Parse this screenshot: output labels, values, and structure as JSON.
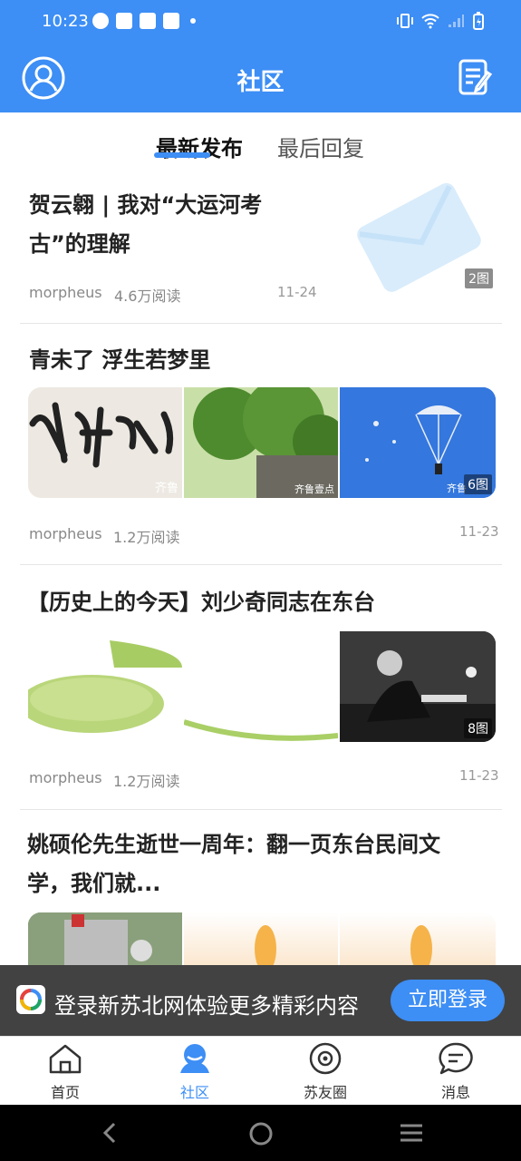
{
  "status_bar": {
    "time": "10:23"
  },
  "header": {
    "title": "社区"
  },
  "tabs": [
    {
      "label": "最新发布"
    },
    {
      "label": "最后回复"
    }
  ],
  "posts": [
    {
      "title_line1": "贺云翱 | 我对“大运河考",
      "title_line2": "古”的理解",
      "author": "morpheus",
      "reads": "4.6万阅读",
      "date": "11-24",
      "image_count": "2图"
    },
    {
      "title": "青未了 浮生若梦里",
      "author": "morpheus",
      "reads": "1.2万阅读",
      "date": "11-23",
      "watermark": "齐鲁",
      "watermark2": "齐鲁壹点",
      "image_count": "6图"
    },
    {
      "title": "【历史上的今天】刘少奇同志在东台",
      "author": "morpheus",
      "reads": "1.2万阅读",
      "date": "11-23",
      "image_count": "8图"
    },
    {
      "title_line1": "姚硕伦先生逝世一周年：翻一页东台民间文",
      "title_line2": "学，我们就..."
    }
  ],
  "banner": {
    "text": "登录新苏北网体验更多精彩内容",
    "button": "立即登录"
  },
  "bottom_nav": [
    {
      "label": "首页",
      "icon": "home-icon"
    },
    {
      "label": "社区",
      "icon": "community-icon"
    },
    {
      "label": "苏友圈",
      "icon": "circle-icon"
    },
    {
      "label": "消息",
      "icon": "message-icon"
    }
  ],
  "colors": {
    "brand": "#3d8ef5"
  }
}
